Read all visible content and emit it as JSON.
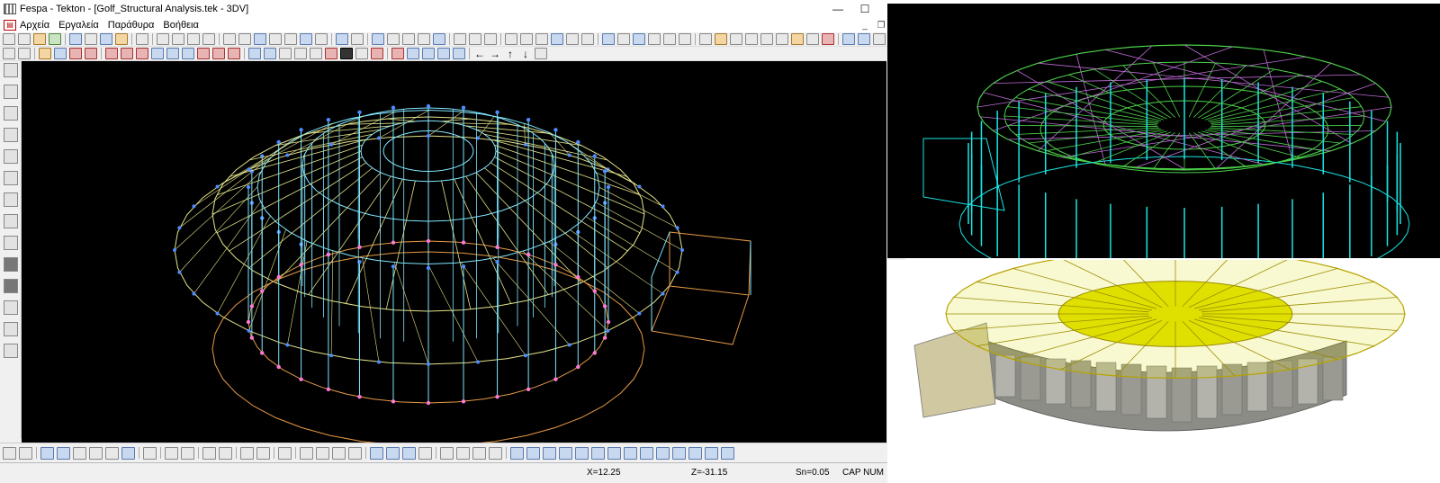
{
  "window": {
    "title": "Fespa - Tekton - [Golf_Structural Analysis.tek - 3DV]",
    "minimize": "—",
    "maximize": "☐",
    "close": "✕"
  },
  "menu": {
    "items": [
      "Αρχεία",
      "Εργαλεία",
      "Παράθυρα",
      "Βοήθεια"
    ],
    "mdi_minimize": "_",
    "mdi_restore": "❐",
    "mdi_close": "×"
  },
  "toolbar2": {
    "arrows": [
      "←",
      "→",
      "↑",
      "↓"
    ]
  },
  "status": {
    "x": "X=12.25",
    "z": "Z=-31.15",
    "sn": "Sn=0.05",
    "flags": "CAP NUM"
  },
  "colors": {
    "viewport_bg": "#000000",
    "wire_cyan": "#7fe6ff",
    "wire_yellow": "#e4e48a",
    "wire_orange": "#e69a45",
    "node_blue": "#4f8cff",
    "node_pink": "#ff79d6",
    "render_green": "#4cd14a",
    "render_cyan": "#19e5e5",
    "roof_yellow": "#e0e000",
    "wall_beige": "#cfc8a0"
  },
  "icons": {
    "app": "fespa-app-icon",
    "document": "tekton-doc-icon"
  }
}
